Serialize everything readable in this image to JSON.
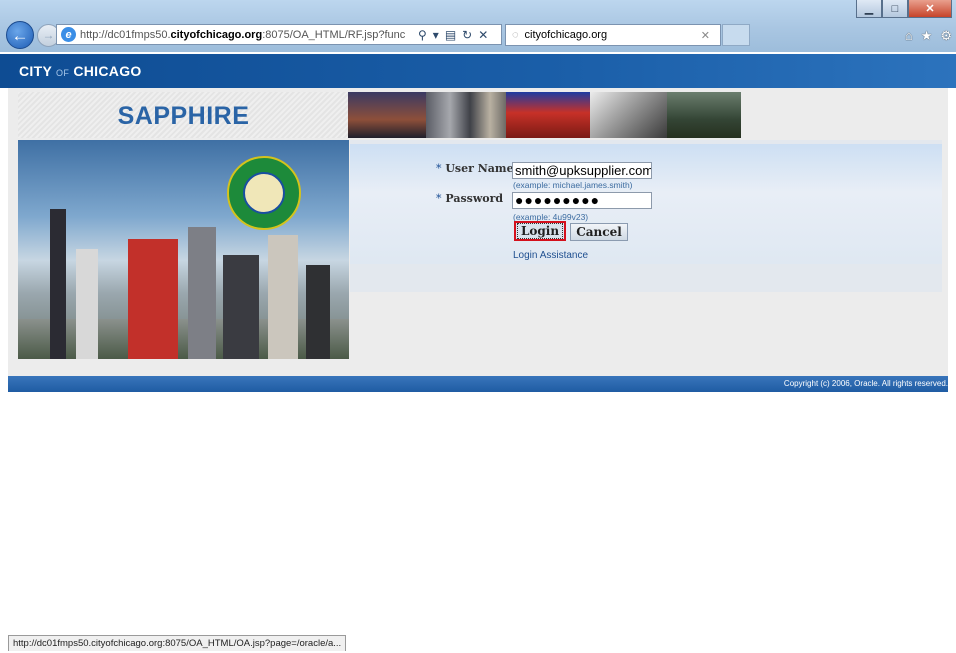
{
  "browser": {
    "url_prefix": "http://dc01fmps50.",
    "url_domain": "cityofchicago.org",
    "url_suffix": ":8075/OA_HTML/RF.jsp?func",
    "addr_icons": [
      "search-icon",
      "dropdown-icon",
      "compat-icon",
      "refresh-icon",
      "stop-icon"
    ],
    "tab_title": "cityofchicago.org",
    "window_buttons": [
      "minimize",
      "maximize",
      "close"
    ],
    "toolbar_icons": [
      "home-icon",
      "favorites-icon",
      "settings-icon"
    ]
  },
  "header": {
    "city_label_1": "CITY",
    "city_label_of": "OF",
    "city_label_2": "CHICAGO"
  },
  "brand": {
    "title": "SAPPHIRE"
  },
  "login": {
    "username_label": "User Name",
    "username_value": "smith@upksupplier.com",
    "username_hint": "(example: michael.james.smith)",
    "password_label": "Password",
    "password_value": "●●●●●●●●●",
    "password_hint": "(example: 4u99v23)",
    "required_marker": "*",
    "login_button": "Login",
    "cancel_button": "Cancel",
    "assistance_link": "Login Assistance"
  },
  "footer": {
    "copyright": "Copyright (c) 2006, Oracle. All rights reserved."
  },
  "statusbar": {
    "text": "http://dc01fmps50.cityofchicago.org:8075/OA_HTML/OA.jsp?page=/oracle/a..."
  }
}
